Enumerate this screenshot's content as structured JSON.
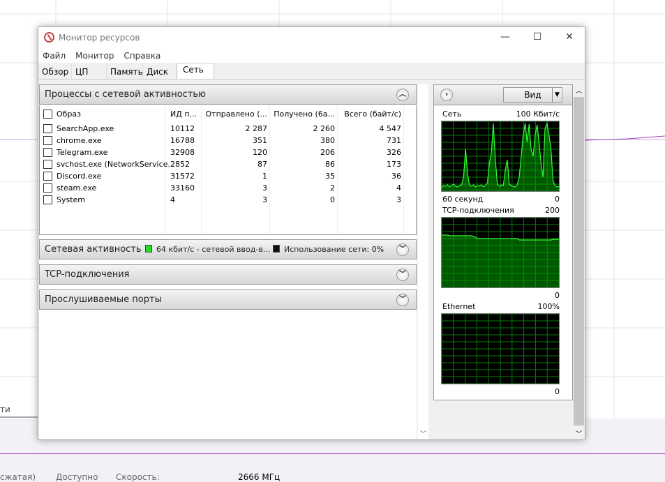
{
  "window": {
    "title": "Монитор ресурсов",
    "minimize": "—",
    "maximize": "☐",
    "close": "✕"
  },
  "menu": [
    "Файл",
    "Монитор",
    "Справка"
  ],
  "tabs": [
    "Обзор",
    "ЦП",
    "Память",
    "Диск",
    "Сеть"
  ],
  "active_tab": "Сеть",
  "processes": {
    "title": "Процессы с сетевой активностью",
    "columns": [
      "Образ",
      "ИД п...",
      "Отправлено (...",
      "Получено (6а...",
      "Всего (байт/с)"
    ],
    "rows": [
      [
        "SearchApp.exe",
        "10112",
        "2 287",
        "2 260",
        "4 547"
      ],
      [
        "chrome.exe",
        "16788",
        "351",
        "380",
        "731"
      ],
      [
        "Telegram.exe",
        "32908",
        "120",
        "206",
        "326"
      ],
      [
        "svchost.exe (NetworkService...",
        "2852",
        "87",
        "86",
        "173"
      ],
      [
        "Discord.exe",
        "31572",
        "1",
        "35",
        "36"
      ],
      [
        "steam.exe",
        "33160",
        "3",
        "2",
        "4"
      ],
      [
        "System",
        "4",
        "3",
        "0",
        "3"
      ]
    ]
  },
  "network_activity": {
    "title": "Сетевая активность",
    "io": "64 кбит/с - сетевой ввод-в...",
    "usage": "Использование сети: 0%"
  },
  "tcp": {
    "title": "TCP-подключения"
  },
  "ports": {
    "title": "Прослушиваемые порты"
  },
  "right": {
    "view_button": "Вид",
    "graphs": [
      {
        "label": "Сеть",
        "max": "100 Кбит/с",
        "footer_left": "60 секунд",
        "footer_right": "0"
      },
      {
        "label": "TCP-подключения",
        "max": "200",
        "footer_right": "0"
      },
      {
        "label": "Ethernet",
        "max": "100%",
        "footer_right": "0"
      }
    ]
  },
  "series": {
    "network": [
      5,
      8,
      7,
      9,
      6,
      8,
      10,
      7,
      6,
      8,
      9,
      20,
      60,
      25,
      8,
      7,
      9,
      6,
      8,
      7,
      9,
      6,
      8,
      12,
      40,
      55,
      97,
      45,
      10,
      7,
      9,
      8,
      30,
      45,
      10,
      8,
      7,
      6,
      9,
      20,
      50,
      80,
      97,
      70,
      96,
      60,
      50,
      80,
      95,
      70,
      40,
      20,
      90,
      97,
      80,
      60,
      15,
      8,
      6,
      7
    ],
    "tcp": [
      75,
      75,
      75,
      75,
      74,
      74,
      74,
      74,
      74,
      74,
      74,
      74,
      74,
      74,
      74,
      74,
      73,
      72,
      70,
      70,
      70,
      70,
      70,
      70,
      70,
      70,
      70,
      70,
      70,
      70,
      70,
      70,
      70,
      70,
      70,
      70,
      70,
      70,
      70,
      68,
      68,
      68,
      68,
      68,
      68,
      68,
      68,
      68,
      68,
      68,
      68,
      68,
      68,
      68,
      68,
      68,
      69,
      69,
      69,
      69
    ],
    "ethernet": []
  },
  "background": {
    "left_label": "ти",
    "items": [
      "сжатая)",
      "Доступно",
      "Скорость:",
      "2666 МГц"
    ]
  }
}
